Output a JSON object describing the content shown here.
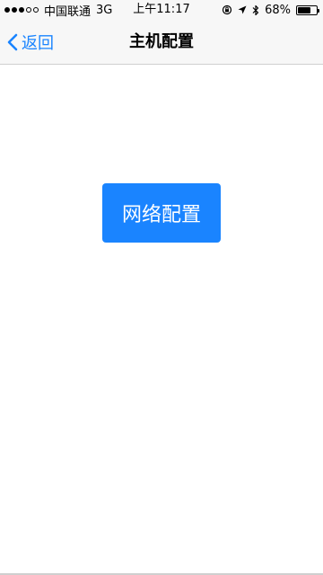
{
  "status_bar": {
    "signal_filled": 3,
    "signal_total": 5,
    "carrier": "中国联通",
    "network": "3G",
    "time": "上午11:17",
    "battery_percent": "68%",
    "battery_level": 0.68,
    "icons": [
      "orientation-lock-icon",
      "location-arrow-icon",
      "bluetooth-icon",
      "battery-icon"
    ]
  },
  "nav": {
    "back_label": "返回",
    "title": "主机配置"
  },
  "main": {
    "network_config_label": "网络配置"
  },
  "colors": {
    "accent": "#1a84ff",
    "bar_background": "#f7f7f7"
  }
}
